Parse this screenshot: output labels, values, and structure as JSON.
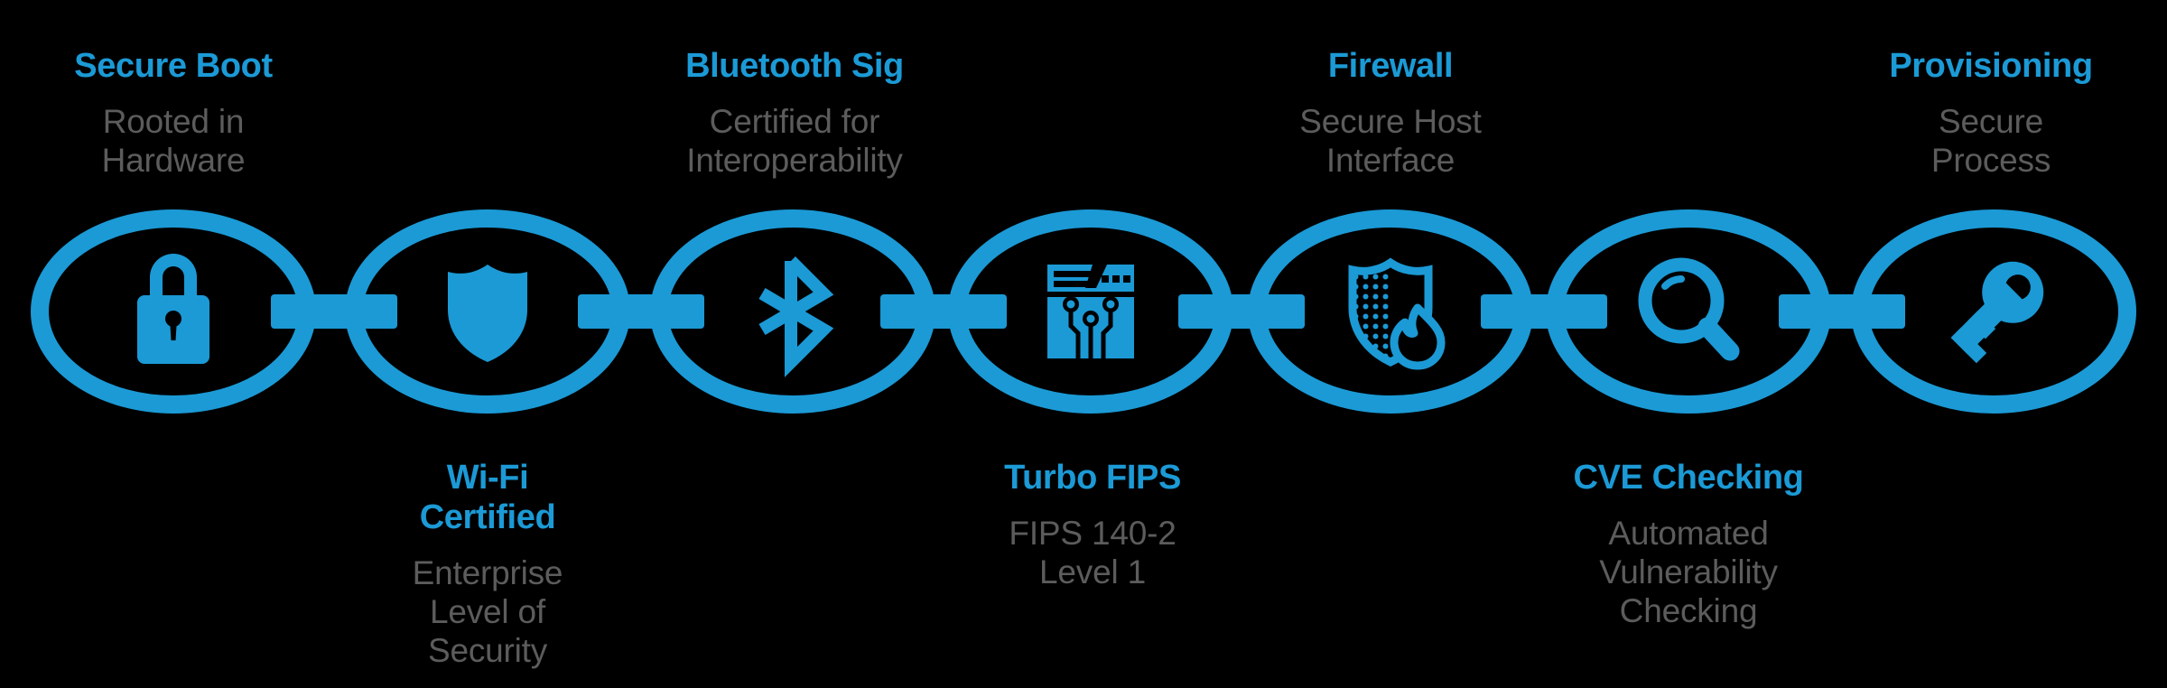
{
  "theme": {
    "background": "#000000",
    "accent_blue": "#1b9ad6",
    "subtext_gray": "#5c5c5c"
  },
  "diagram": {
    "type": "linked-chain",
    "node_count": 7,
    "nodes": [
      {
        "index": 1,
        "icon": "lock-icon",
        "title": "Secure Boot",
        "subtitle": "Rooted in\nHardware",
        "label_position": "top"
      },
      {
        "index": 2,
        "icon": "shield-icon",
        "title": "Wi-Fi\nCertified",
        "subtitle": "Enterprise\nLevel of\nSecurity",
        "label_position": "bottom"
      },
      {
        "index": 3,
        "icon": "bluetooth-icon",
        "title": "Bluetooth Sig",
        "subtitle": "Certified for\nInteroperability",
        "label_position": "top"
      },
      {
        "index": 4,
        "icon": "circuit-window-icon",
        "title": "Turbo FIPS",
        "subtitle": "FIPS 140-2\nLevel 1",
        "label_position": "bottom"
      },
      {
        "index": 5,
        "icon": "shield-flame-icon",
        "title": "Firewall",
        "subtitle": "Secure Host\nInterface",
        "label_position": "top"
      },
      {
        "index": 6,
        "icon": "magnifying-glass-icon",
        "title": "CVE Checking",
        "subtitle": "Automated\nVulnerability\nChecking",
        "label_position": "bottom"
      },
      {
        "index": 7,
        "icon": "key-icon",
        "title": "Provisioning",
        "subtitle": "Secure\nProcess",
        "label_position": "top"
      }
    ]
  }
}
